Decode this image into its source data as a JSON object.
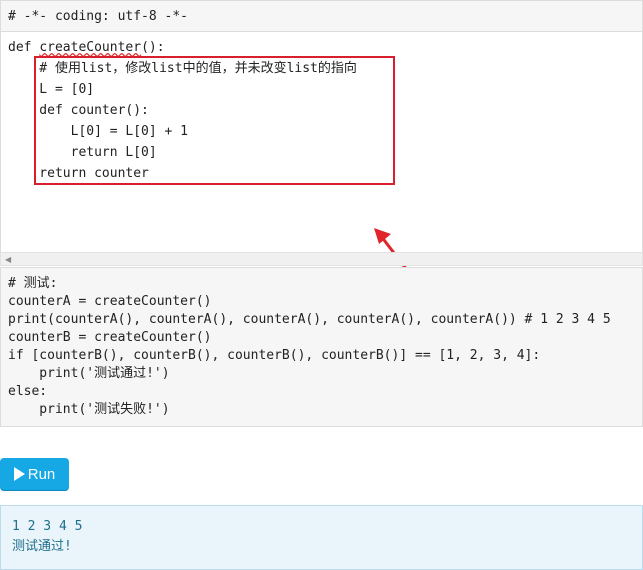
{
  "editor": {
    "header_line": "# -*- coding: utf-8 -*-",
    "lines": [
      "def createCounter():",
      "    # 使用list，修改list中的值，并未改变list的指向",
      "    L = [0]",
      "    def counter():",
      "        L[0] = L[0] + 1",
      "        return L[0]",
      "    return counter"
    ],
    "def_keyword": "def ",
    "func_name": "createCounter",
    "func_suffix": "():"
  },
  "test_code": {
    "lines": [
      "# 测试:",
      "counterA = createCounter()",
      "print(counterA(), counterA(), counterA(), counterA(), counterA()) # 1 2 3 4 5",
      "counterB = createCounter()",
      "if [counterB(), counterB(), counterB(), counterB()] == [1, 2, 3, 4]:",
      "    print('测试通过!')",
      "else:",
      "    print('测试失败!')"
    ]
  },
  "run_button": {
    "label": "Run",
    "icon": "play-icon"
  },
  "output": {
    "lines": [
      "1 2 3 4 5",
      "测试通过!"
    ]
  },
  "colors": {
    "highlight": "#d91e2e",
    "run": "#16a7e5",
    "output_bg": "#eaf5fb"
  }
}
